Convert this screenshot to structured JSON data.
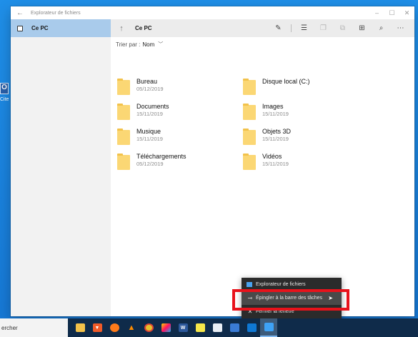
{
  "desktop": {
    "partial_icon_text": "O",
    "partial_icon_label": "Cite"
  },
  "window": {
    "title": "Explorateur de fichiers",
    "controls": {
      "minimize": "–",
      "maximize": "☐",
      "close": "✕"
    }
  },
  "sidebar": {
    "items": [
      {
        "label": "Ce PC",
        "icon": "pc-icon",
        "selected": true
      }
    ]
  },
  "toolbar": {
    "breadcrumb": "Ce PC",
    "icons": [
      "pencil-icon",
      "list-view-icon",
      "new-file-icon",
      "copy-icon",
      "grid-view-icon",
      "search-icon",
      "more-icon"
    ]
  },
  "sort": {
    "label": "Trier par :",
    "value": "Nom"
  },
  "folders": [
    {
      "name": "Bureau",
      "date": "05/12/2019"
    },
    {
      "name": "Disque local (C:)",
      "date": ""
    },
    {
      "name": "Documents",
      "date": "15/11/2019"
    },
    {
      "name": "Images",
      "date": "15/11/2019"
    },
    {
      "name": "Musique",
      "date": "15/11/2019"
    },
    {
      "name": "Objets 3D",
      "date": "15/11/2019"
    },
    {
      "name": "Téléchargements",
      "date": "05/12/2019"
    },
    {
      "name": "Vidéos",
      "date": "15/11/2019"
    }
  ],
  "context_menu": {
    "items": [
      {
        "label": "Explorateur de fichiers",
        "icon": "folder-icon"
      },
      {
        "label": "Épingler à la barre des tâches",
        "icon": "pin-icon"
      },
      {
        "label": "Fermer la fenêtre",
        "icon": "close-icon"
      }
    ]
  },
  "taskbar": {
    "search_text": "ercher",
    "apps": [
      "file-explorer",
      "brave",
      "firefox",
      "vlc",
      "chrome",
      "paint",
      "word",
      "sticky-notes",
      "chart",
      "people",
      "outlook",
      "file-explorer-active"
    ]
  },
  "colors": {
    "accent": "#a9cbeb",
    "highlight": "#e8121b",
    "folder": "#fbd774",
    "taskbar": "#0f2b4a"
  }
}
